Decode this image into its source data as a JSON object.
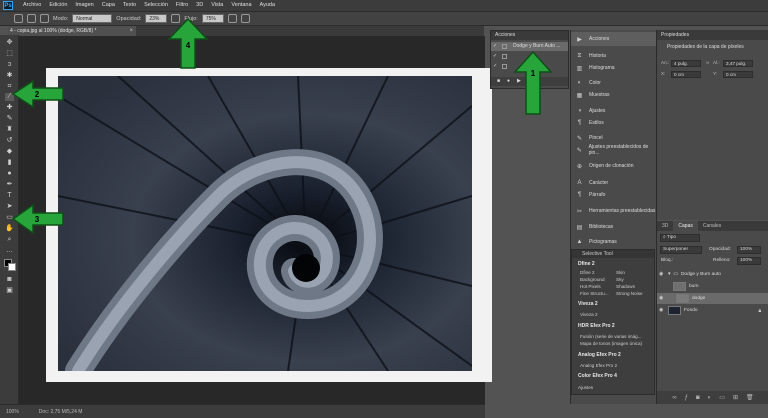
{
  "app": {
    "logo": "Ps"
  },
  "menu": [
    "Archivo",
    "Edición",
    "Imagen",
    "Capa",
    "Texto",
    "Selección",
    "Filtro",
    "3D",
    "Vista",
    "Ventana",
    "Ayuda"
  ],
  "options_bar": {
    "mode_label": "Modo:",
    "mode_value": "Normal",
    "opacity_label": "Opacidad:",
    "opacity_value": "23%",
    "flow_label": "Flujo:",
    "flow_value": "75%"
  },
  "document": {
    "tab_title": "4 - copia.jpg al 100% (dodge, RGB/8) *",
    "close_glyph": "×"
  },
  "statusbar": {
    "zoom": "100%",
    "doc_info": "Doc: 2,75 M/5,24 M"
  },
  "actions_panel": {
    "title": "Acciones",
    "rows": [
      {
        "check": "✓",
        "name": "Dodge y Burn Auto ..."
      },
      {
        "check": "✓",
        "name": ""
      },
      {
        "check": "✓",
        "name": ""
      },
      {
        "check": "",
        "name": ""
      }
    ]
  },
  "mid_dock": {
    "items": [
      {
        "icon": "▶",
        "label": "Acciones",
        "active": true
      },
      {
        "icon": "⧖",
        "label": "Historia"
      },
      {
        "icon": "▥",
        "label": "Histograma"
      },
      {
        "icon": "◐",
        "label": "Color"
      },
      {
        "icon": "▦",
        "label": "Muestras"
      },
      {
        "icon": "◑",
        "label": "Ajustes"
      },
      {
        "icon": "¶",
        "label": "Estilos"
      },
      {
        "icon": "✎",
        "label": "Pincel"
      },
      {
        "icon": "✎",
        "label": "Ajustes preestablecidos de pin..."
      },
      {
        "icon": "⊕",
        "label": "Origen de clonación"
      },
      {
        "icon": "A",
        "label": "Carácter"
      },
      {
        "icon": "¶",
        "label": "Párrafo"
      },
      {
        "icon": "✂",
        "label": "Herramientas preestablecidas"
      },
      {
        "icon": "▤",
        "label": "Bibliotecas"
      },
      {
        "icon": "▲",
        "label": "Pictogramas"
      }
    ]
  },
  "selective_tool": {
    "title": "Selective Tool",
    "sections": [
      {
        "name": "Dfine 2",
        "items": [
          [
            "Dfine 2",
            "Skin"
          ],
          [
            "Background",
            "Sky"
          ],
          [
            "Hot Pixels",
            "Shadows"
          ],
          [
            "Fine Structu...",
            "Strong Noise"
          ]
        ]
      },
      {
        "name": "Viveza 2",
        "items": [
          [
            "Viveza 2"
          ]
        ]
      },
      {
        "name": "HDR Efex Pro 2",
        "items": [
          [
            "Fusión (serie de varias imág..."
          ],
          [
            "Mapa de tonos (imagen única)"
          ]
        ]
      },
      {
        "name": "Analog Efex Pro 2",
        "items": [
          [
            "Analog Efex Pro 2"
          ]
        ]
      },
      {
        "name": "Color Efex Pro 4",
        "items": []
      }
    ],
    "footer": "Ajustes"
  },
  "properties": {
    "header": "Propiedades",
    "title": "Propiedades de la capa de píxeles",
    "an_label": "An.:",
    "an_value": "4 pulg.",
    "al_label": "Al.:",
    "al_value": "3,47 pulg.",
    "x_label": "X:",
    "x_value": "0 cm",
    "y_label": "Y:",
    "y_value": "0 cm"
  },
  "layers": {
    "tabs": [
      "3D",
      "Capas",
      "Canales"
    ],
    "filter": "Tipo",
    "blend": "Superponer",
    "opacity_label": "Opacidad:",
    "opacity_value": "100%",
    "lock_label": "Bloq.:",
    "fill_label": "Relleno:",
    "fill_value": "100%",
    "rows": [
      {
        "name": "Dodge y Burn auto",
        "group": true
      },
      {
        "name": "burn"
      },
      {
        "name": "dodge",
        "selected": true
      },
      {
        "name": "Fondo",
        "locked": true
      }
    ]
  },
  "callouts": [
    "1",
    "2",
    "3",
    "4"
  ],
  "colors": {
    "arrow": "#27a53a",
    "arrow_stroke": "#0e4f18",
    "panel": "#4a4a4a"
  }
}
